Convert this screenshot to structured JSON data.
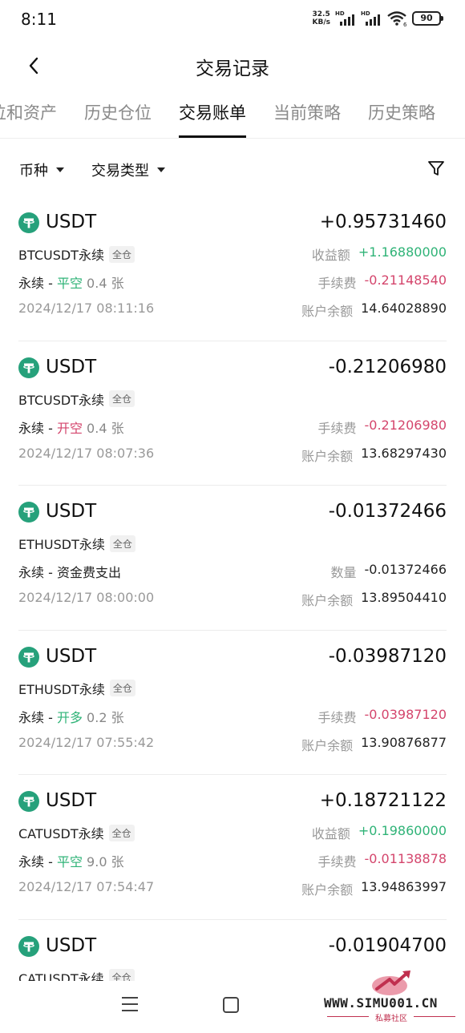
{
  "status": {
    "time": "8:11",
    "net_speed_value": "32.5",
    "net_speed_unit": "KB/s",
    "hd1": "HD",
    "hd2": "HD",
    "wifi_badge": "6",
    "battery": "90"
  },
  "header": {
    "title": "交易记录"
  },
  "tabs": [
    {
      "label": "位和资产",
      "active": false
    },
    {
      "label": "历史仓位",
      "active": false
    },
    {
      "label": "交易账单",
      "active": true
    },
    {
      "label": "当前策略",
      "active": false
    },
    {
      "label": "历史策略",
      "active": false
    }
  ],
  "filters": {
    "coin": "币种",
    "trade_type": "交易类型"
  },
  "records": [
    {
      "coin": "USDT",
      "amount": "+0.95731460",
      "symbol": "BTCUSDT永续",
      "margin": "全仓",
      "type_prefix": "永续 - ",
      "type_action": "平空",
      "type_quantity": " 0.4 张",
      "timestamp": "2024/12/17 08:11:16",
      "profit_label": "收益额",
      "profit_value": "+1.16880000",
      "fee_label": "手续费",
      "fee_value": "-0.21148540",
      "balance_label": "账户余额",
      "balance_value": "14.64028890"
    },
    {
      "coin": "USDT",
      "amount": "-0.21206980",
      "symbol": "BTCUSDT永续",
      "margin": "全仓",
      "type_prefix": "永续 - ",
      "type_action": "开空",
      "type_quantity": " 0.4 张",
      "timestamp": "2024/12/17 08:07:36",
      "fee_label": "手续费",
      "fee_value": "-0.21206980",
      "balance_label": "账户余额",
      "balance_value": "13.68297430"
    },
    {
      "coin": "USDT",
      "amount": "-0.01372466",
      "symbol": "ETHUSDT永续",
      "margin": "全仓",
      "type_prefix": "永续 - 资金费支出",
      "timestamp": "2024/12/17 08:00:00",
      "qty_label": "数量",
      "qty_value": "-0.01372466",
      "balance_label": "账户余额",
      "balance_value": "13.89504410"
    },
    {
      "coin": "USDT",
      "amount": "-0.03987120",
      "symbol": "ETHUSDT永续",
      "margin": "全仓",
      "type_prefix": "永续 - ",
      "type_action": "开多",
      "type_quantity": " 0.2 张",
      "timestamp": "2024/12/17 07:55:42",
      "fee_label": "手续费",
      "fee_value": "-0.03987120",
      "balance_label": "账户余额",
      "balance_value": "13.90876877"
    },
    {
      "coin": "USDT",
      "amount": "+0.18721122",
      "symbol": "CATUSDT永续",
      "margin": "全仓",
      "type_prefix": "永续 - ",
      "type_action": "平空",
      "type_quantity": " 9.0 张",
      "timestamp": "2024/12/17 07:54:47",
      "profit_label": "收益额",
      "profit_value": "+0.19860000",
      "fee_label": "手续费",
      "fee_value": "-0.01138878",
      "balance_label": "账户余额",
      "balance_value": "13.94863997"
    },
    {
      "coin": "USDT",
      "amount": "-0.01904700",
      "symbol": "CATUSDT永续",
      "margin": "全仓"
    }
  ],
  "watermark": {
    "url": "WWW.SIMU001.CN",
    "sub": "私募社区"
  },
  "colors": {
    "green": "#2fb377",
    "red": "#d4456c",
    "tether": "#26a17b"
  }
}
